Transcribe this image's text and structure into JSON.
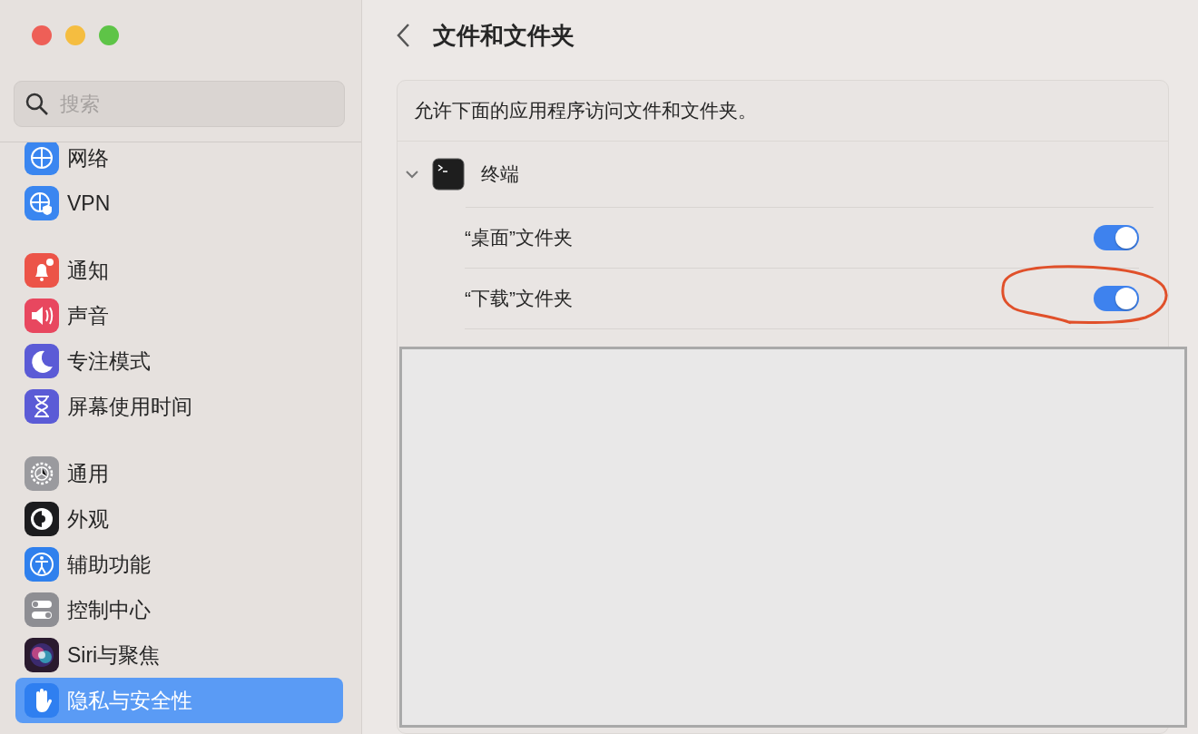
{
  "window": {
    "title": "文件和文件夹"
  },
  "search": {
    "placeholder": "搜索"
  },
  "sidebar": {
    "groups": [
      {
        "items": [
          {
            "label": "网络",
            "color": "#3a86f0",
            "selected": false
          },
          {
            "label": "VPN",
            "color": "#3a86f0",
            "selected": false
          }
        ]
      },
      {
        "items": [
          {
            "label": "通知",
            "color": "#ec5448",
            "selected": false
          },
          {
            "label": "声音",
            "color": "#e8475f",
            "selected": false
          },
          {
            "label": "专注模式",
            "color": "#5b5bd6",
            "selected": false
          },
          {
            "label": "屏幕使用时间",
            "color": "#5b5bd6",
            "selected": false
          }
        ]
      },
      {
        "items": [
          {
            "label": "通用",
            "color": "#9a9a9e",
            "selected": false
          },
          {
            "label": "外观",
            "color": "#1c1c1e",
            "selected": false
          },
          {
            "label": "辅助功能",
            "color": "#2f80ed",
            "selected": false
          },
          {
            "label": "控制中心",
            "color": "#8e8e93",
            "selected": false
          },
          {
            "label": "Siri与聚焦",
            "color": "#2a1a2e",
            "selected": false
          },
          {
            "label": "隐私与安全性",
            "color": "#2f7ff0",
            "selected": true
          }
        ]
      }
    ]
  },
  "panel": {
    "description": "允许下面的应用程序访问文件和文件夹。",
    "apps": [
      {
        "name": "终端",
        "expanded": true,
        "folders": [
          {
            "label": "“桌面”文件夹",
            "on": true
          },
          {
            "label": "“下载”文件夹",
            "on": true
          }
        ]
      }
    ]
  }
}
